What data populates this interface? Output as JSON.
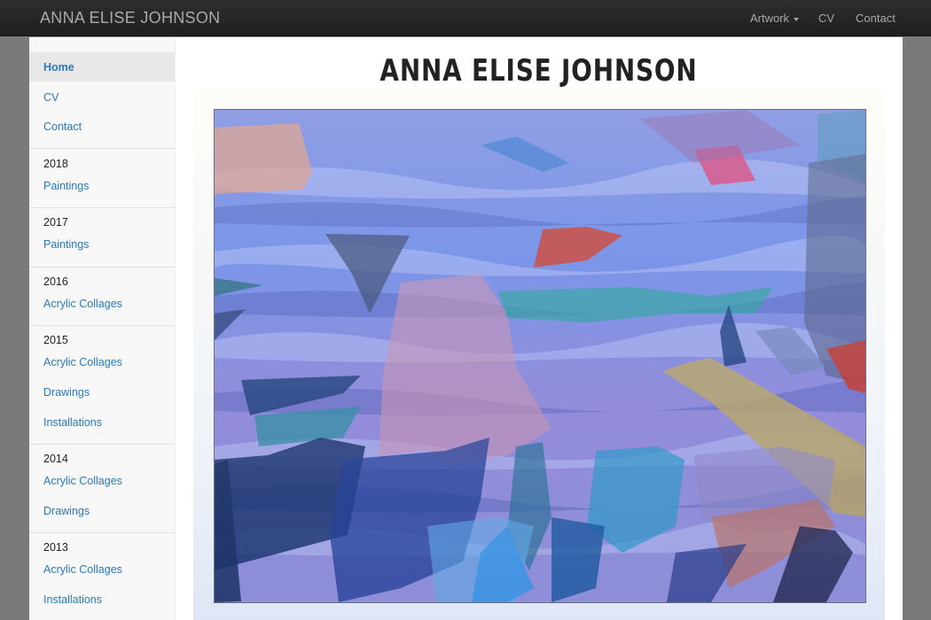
{
  "navbar": {
    "brand": "ANNA ELISE JOHNSON",
    "links": [
      {
        "label": "Artwork",
        "dropdown": true
      },
      {
        "label": "CV"
      },
      {
        "label": "Contact"
      }
    ]
  },
  "sidebar": {
    "top_links": [
      "Home",
      "CV",
      "Contact"
    ],
    "sections": [
      {
        "year": "2018",
        "items": [
          "Paintings"
        ]
      },
      {
        "year": "2017",
        "items": [
          "Paintings"
        ]
      },
      {
        "year": "2016",
        "items": [
          "Acrylic Collages"
        ]
      },
      {
        "year": "2015",
        "items": [
          "Acrylic Collages",
          "Drawings",
          "Installations"
        ]
      },
      {
        "year": "2014",
        "items": [
          "Acrylic Collages",
          "Drawings"
        ]
      },
      {
        "year": "2013",
        "items": [
          "Acrylic Collages",
          "Installations"
        ]
      }
    ]
  },
  "main": {
    "title": "ANNA ELISE JOHNSON"
  },
  "colors": {
    "link": "#2a7ab8",
    "navbar": "#222222",
    "nav_text": "#a9a9a9"
  }
}
